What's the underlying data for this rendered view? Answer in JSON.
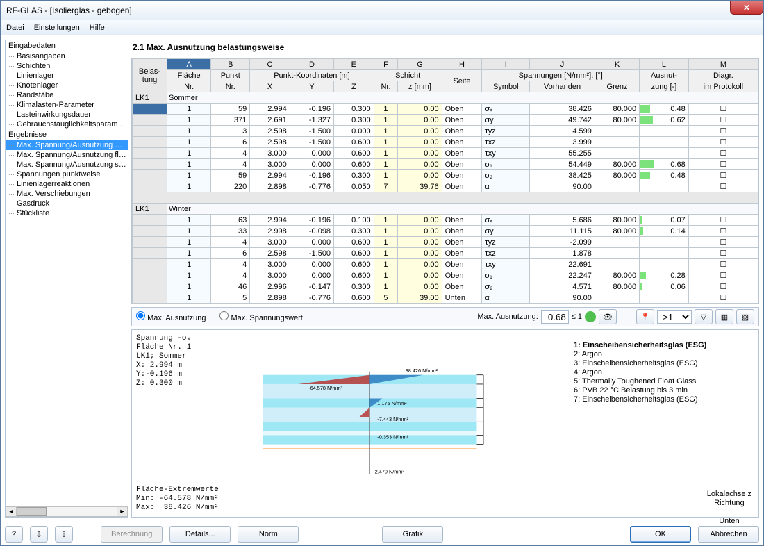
{
  "window": {
    "title": "RF-GLAS - [Isolierglas - gebogen]"
  },
  "menubar": [
    "Datei",
    "Einstellungen",
    "Hilfe"
  ],
  "tree": {
    "groups": [
      {
        "label": "Eingabedaten",
        "items": [
          "Basisangaben",
          "Schichten",
          "Linienlager",
          "Knotenlager",
          "Randstäbe",
          "Klimalasten-Parameter",
          "Lasteinwirkungsdauer",
          "Gebrauchstauglichkeitsparameter"
        ]
      },
      {
        "label": "Ergebnisse",
        "items": [
          "Max. Spannung/Ausnutzung belastungsweise",
          "Max. Spannung/Ausnutzung flächenweise",
          "Max. Spannung/Ausnutzung schichtweise",
          "Spannungen punktweise",
          "Linienlagerreaktionen",
          "Max. Verschiebungen",
          "Gasdruck",
          "Stückliste"
        ],
        "selected": 0
      }
    ]
  },
  "section_title": "2.1 Max. Ausnutzung belastungsweise",
  "col_letters": [
    "A",
    "B",
    "C",
    "D",
    "E",
    "F",
    "G",
    "H",
    "I",
    "J",
    "K",
    "L",
    "M"
  ],
  "header_groups": {
    "belas": "Belas-",
    "tung": "tung",
    "flache": "Fläche",
    "nr": "Nr.",
    "punkt": "Punkt",
    "pk": "Punkt-Koordinaten [m]",
    "x": "X",
    "y": "Y",
    "z": "Z",
    "schicht": "Schicht",
    "snr": "Nr.",
    "zmm": "z [mm]",
    "seite": "Seite",
    "span": "Spannungen [N/mm²], [°]",
    "sym": "Symbol",
    "vor": "Vorhanden",
    "grenz": "Grenz",
    "ausn": "Ausnut-",
    "zung": "zung [-]",
    "diag": "Diagr.",
    "prot": "im Protokoll"
  },
  "groups": [
    {
      "lk": "LK1",
      "name": "Sommer",
      "rows": [
        {
          "fn": 1,
          "pn": 59,
          "x": "2.994",
          "y": "-0.196",
          "z": "0.300",
          "sn": 1,
          "zmm": "0.00",
          "seite": "Oben",
          "sym": "σₓ",
          "vor": "38.426",
          "gr": "80.000",
          "az": "0.48",
          "bar": 20,
          "ck": true
        },
        {
          "fn": 1,
          "pn": 371,
          "x": "2.691",
          "y": "-1.327",
          "z": "0.300",
          "sn": 1,
          "zmm": "0.00",
          "seite": "Oben",
          "sym": "σy",
          "vor": "49.742",
          "gr": "80.000",
          "az": "0.62",
          "bar": 26,
          "ck": true
        },
        {
          "fn": 1,
          "pn": 3,
          "x": "2.598",
          "y": "-1.500",
          "z": "0.000",
          "sn": 1,
          "zmm": "0.00",
          "seite": "Oben",
          "sym": "τyz",
          "vor": "4.599",
          "gr": "",
          "az": "",
          "bar": 0,
          "ck": true
        },
        {
          "fn": 1,
          "pn": 6,
          "x": "2.598",
          "y": "-1.500",
          "z": "0.600",
          "sn": 1,
          "zmm": "0.00",
          "seite": "Oben",
          "sym": "τxz",
          "vor": "3.999",
          "gr": "",
          "az": "",
          "bar": 0,
          "ck": true
        },
        {
          "fn": 1,
          "pn": 4,
          "x": "3.000",
          "y": "0.000",
          "z": "0.600",
          "sn": 1,
          "zmm": "0.00",
          "seite": "Oben",
          "sym": "τxy",
          "vor": "55.255",
          "gr": "",
          "az": "",
          "bar": 0,
          "ck": true
        },
        {
          "fn": 1,
          "pn": 4,
          "x": "3.000",
          "y": "0.000",
          "z": "0.600",
          "sn": 1,
          "zmm": "0.00",
          "seite": "Oben",
          "sym": "σ₁",
          "vor": "54.449",
          "gr": "80.000",
          "az": "0.68",
          "bar": 28,
          "ck": true
        },
        {
          "fn": 1,
          "pn": 59,
          "x": "2.994",
          "y": "-0.196",
          "z": "0.300",
          "sn": 1,
          "zmm": "0.00",
          "seite": "Oben",
          "sym": "σ₂",
          "vor": "38.425",
          "gr": "80.000",
          "az": "0.48",
          "bar": 20,
          "ck": true
        },
        {
          "fn": 1,
          "pn": 220,
          "x": "2.898",
          "y": "-0.776",
          "z": "0.050",
          "sn": 7,
          "zmm": "39.76",
          "seite": "Oben",
          "sym": "α",
          "vor": "90.00",
          "gr": "",
          "az": "",
          "bar": 0,
          "ck": true
        }
      ]
    },
    {
      "lk": "LK1",
      "name": "Winter",
      "rows": [
        {
          "fn": 1,
          "pn": 63,
          "x": "2.994",
          "y": "-0.196",
          "z": "0.100",
          "sn": 1,
          "zmm": "0.00",
          "seite": "Oben",
          "sym": "σₓ",
          "vor": "5.686",
          "gr": "80.000",
          "az": "0.07",
          "bar": 3,
          "ck": true
        },
        {
          "fn": 1,
          "pn": 33,
          "x": "2.998",
          "y": "-0.098",
          "z": "0.300",
          "sn": 1,
          "zmm": "0.00",
          "seite": "Oben",
          "sym": "σy",
          "vor": "11.115",
          "gr": "80.000",
          "az": "0.14",
          "bar": 6,
          "ck": true
        },
        {
          "fn": 1,
          "pn": 4,
          "x": "3.000",
          "y": "0.000",
          "z": "0.600",
          "sn": 1,
          "zmm": "0.00",
          "seite": "Oben",
          "sym": "τyz",
          "vor": "-2.099",
          "gr": "",
          "az": "",
          "bar": 0,
          "ck": true
        },
        {
          "fn": 1,
          "pn": 6,
          "x": "2.598",
          "y": "-1.500",
          "z": "0.600",
          "sn": 1,
          "zmm": "0.00",
          "seite": "Oben",
          "sym": "τxz",
          "vor": "1.878",
          "gr": "",
          "az": "",
          "bar": 0,
          "ck": true
        },
        {
          "fn": 1,
          "pn": 4,
          "x": "3.000",
          "y": "0.000",
          "z": "0.600",
          "sn": 1,
          "zmm": "0.00",
          "seite": "Oben",
          "sym": "τxy",
          "vor": "22.691",
          "gr": "",
          "az": "",
          "bar": 0,
          "ck": true
        },
        {
          "fn": 1,
          "pn": 4,
          "x": "3.000",
          "y": "0.000",
          "z": "0.600",
          "sn": 1,
          "zmm": "0.00",
          "seite": "Oben",
          "sym": "σ₁",
          "vor": "22.247",
          "gr": "80.000",
          "az": "0.28",
          "bar": 12,
          "ck": true
        },
        {
          "fn": 1,
          "pn": 46,
          "x": "2.996",
          "y": "-0.147",
          "z": "0.300",
          "sn": 1,
          "zmm": "0.00",
          "seite": "Oben",
          "sym": "σ₂",
          "vor": "4.571",
          "gr": "80.000",
          "az": "0.06",
          "bar": 3,
          "ck": true
        },
        {
          "fn": 1,
          "pn": 5,
          "x": "2.898",
          "y": "-0.776",
          "z": "0.600",
          "sn": 5,
          "zmm": "39.00",
          "seite": "Unten",
          "sym": "α",
          "vor": "90.00",
          "gr": "",
          "az": "",
          "bar": 0,
          "ck": true
        }
      ]
    }
  ],
  "optbar": {
    "opt1": "Max. Ausnutzung",
    "opt2": "Max. Spannungswert",
    "label": "Max. Ausnutzung:",
    "value": "0.68",
    "le": "≤ 1",
    "combo": ">1"
  },
  "diagram": {
    "left": "Spannung -σₓ\nFläche Nr. 1\nLK1; Sommer\nX: 2.994 m\nY:-0.196 m\nZ: 0.300 m",
    "extreme": "Fläche-Extremwerte\nMin: -64.578 N/mm²\nMax:  38.426 N/mm²",
    "legend": [
      "1: Einscheibensicherheitsglas (ESG)",
      "2: Argon",
      "3: Einscheibensicherheitsglas (ESG)",
      "4: Argon",
      "5: Thermally Toughened Float Glass",
      "6: PVB 22 °C Belastung bis 3 min",
      "7: Einscheibensicherheitsglas (ESG)"
    ],
    "labels": {
      "top": "38.426 N/mm²",
      "l1": "-64.578 N/mm²",
      "l2": "1.175 N/mm²",
      "l3": "-7.443 N/mm²",
      "l4": "-0.353 N/mm²",
      "bot": "2.470 N/mm²"
    },
    "ax": "Lokalachse z\nRichtung\n\nUnten"
  },
  "buttons": {
    "berechnung": "Berechnung",
    "details": "Details...",
    "norm": "Norm",
    "grafik": "Grafik",
    "ok": "OK",
    "cancel": "Abbrechen"
  }
}
